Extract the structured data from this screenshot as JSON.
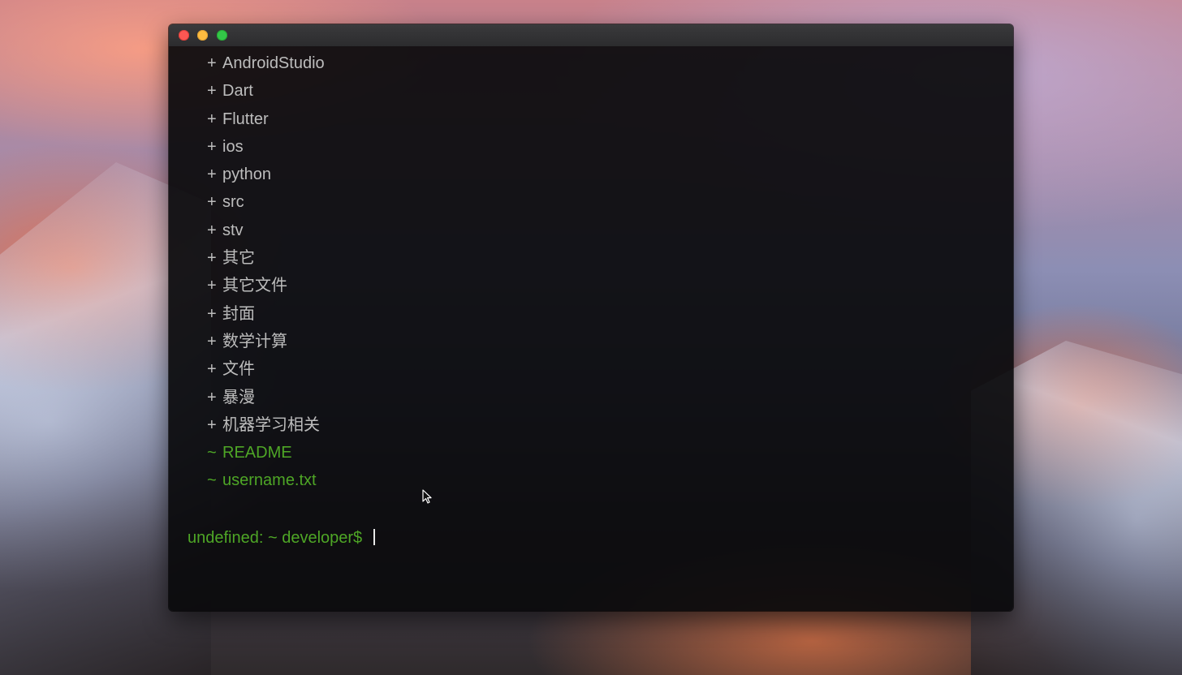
{
  "terminal": {
    "entries": [
      {
        "marker": "+",
        "name": "AndroidStudio",
        "kind": "directory"
      },
      {
        "marker": "+",
        "name": "Dart",
        "kind": "directory"
      },
      {
        "marker": "+",
        "name": "Flutter",
        "kind": "directory"
      },
      {
        "marker": "+",
        "name": "ios",
        "kind": "directory"
      },
      {
        "marker": "+",
        "name": "python",
        "kind": "directory"
      },
      {
        "marker": "+",
        "name": "src",
        "kind": "directory"
      },
      {
        "marker": "+",
        "name": "stv",
        "kind": "directory"
      },
      {
        "marker": "+",
        "name": "其它",
        "kind": "directory"
      },
      {
        "marker": "+",
        "name": "其它文件",
        "kind": "directory"
      },
      {
        "marker": "+",
        "name": "封面",
        "kind": "directory"
      },
      {
        "marker": "+",
        "name": "数学计算",
        "kind": "directory"
      },
      {
        "marker": "+",
        "name": "文件",
        "kind": "directory"
      },
      {
        "marker": "+",
        "name": "暴漫",
        "kind": "directory"
      },
      {
        "marker": "+",
        "name": "机器学习相关",
        "kind": "directory"
      },
      {
        "marker": "~",
        "name": "README",
        "kind": "file"
      },
      {
        "marker": "~",
        "name": "username.txt",
        "kind": "file"
      }
    ],
    "prompt": "undefined: ~ developer$",
    "input_value": ""
  },
  "colors": {
    "directory_text": "#bdbdbd",
    "file_text": "#4ea626",
    "prompt_text": "#4ea626",
    "terminal_background": "#0a0a0c",
    "close_button": "#fc5753",
    "minimize_button": "#fdbc40",
    "maximize_button": "#33c748"
  },
  "icons": {
    "close": "close-icon",
    "minimize": "minimize-icon",
    "maximize": "maximize-icon",
    "pointer": "mouse-pointer-icon"
  }
}
